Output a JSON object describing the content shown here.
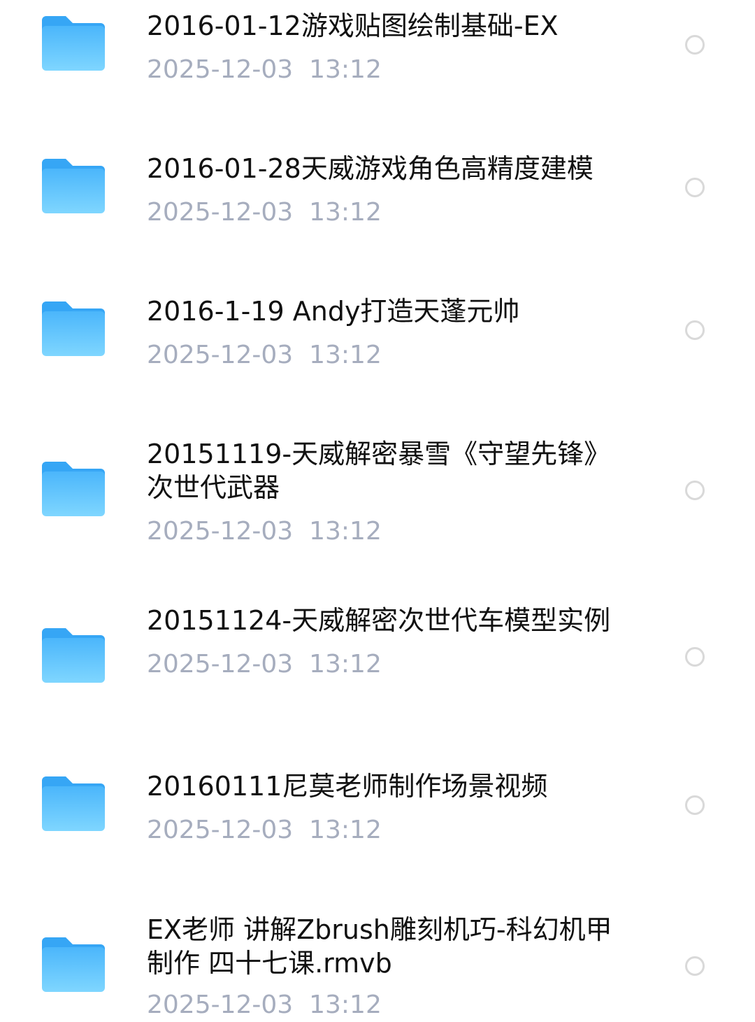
{
  "files": [
    {
      "name": "2016-01-12游戏贴图绘制基础-EX",
      "modified": "2025-12-03  13:12",
      "icon": "folder-icon"
    },
    {
      "name": "2016-01-28天威游戏角色高精度建模",
      "modified": "2025-12-03  13:12",
      "icon": "folder-icon"
    },
    {
      "name": "2016-1-19 Andy打造天蓬元帅",
      "modified": "2025-12-03  13:12",
      "icon": "folder-icon"
    },
    {
      "name": "20151119-天威解密暴雪《守望先锋》次世代武器",
      "modified": "2025-12-03  13:12",
      "icon": "folder-icon"
    },
    {
      "name": "20151124-天威解密次世代车模型实例",
      "modified": "2025-12-03  13:12",
      "icon": "folder-icon"
    },
    {
      "name": "20160111尼莫老师制作场景视频",
      "modified": "2025-12-03  13:12",
      "icon": "folder-icon"
    },
    {
      "name": "EX老师 讲解Zbrush雕刻机巧-科幻机甲制作 四十七课.rmvb",
      "modified": "2025-12-03  13:12",
      "icon": "folder-icon"
    }
  ],
  "colors": {
    "folder_top": "#4bb6fb",
    "folder_bottom": "#7fd6ff",
    "tab": "#36a6f5",
    "name_text": "#111111",
    "time_text": "#a6adbe",
    "radio_border": "#d9d9d9"
  }
}
